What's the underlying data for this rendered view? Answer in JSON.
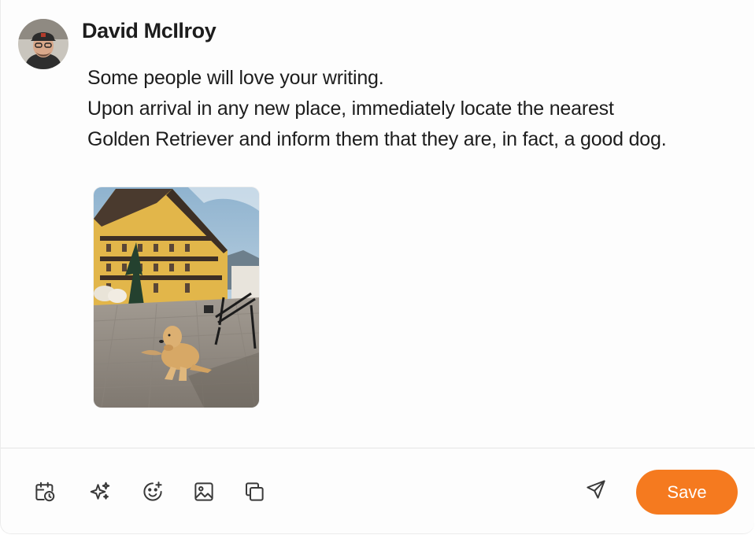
{
  "post": {
    "author": "David McIlroy",
    "lines": [
      "Some people will love your writing.",
      "Upon arrival in any new place, immediately locate the nearest",
      "Golden Retriever and inform them that they are, in fact, a good dog."
    ]
  },
  "toolbar": {
    "icons": [
      "schedule-icon",
      "ai-sparkles-icon",
      "emoji-add-icon",
      "image-icon",
      "copy-icon",
      "send-icon"
    ],
    "save_label": "Save"
  },
  "colors": {
    "accent": "#f57a1f",
    "icon": "#3a3a3a",
    "text": "#1d1d1d"
  }
}
